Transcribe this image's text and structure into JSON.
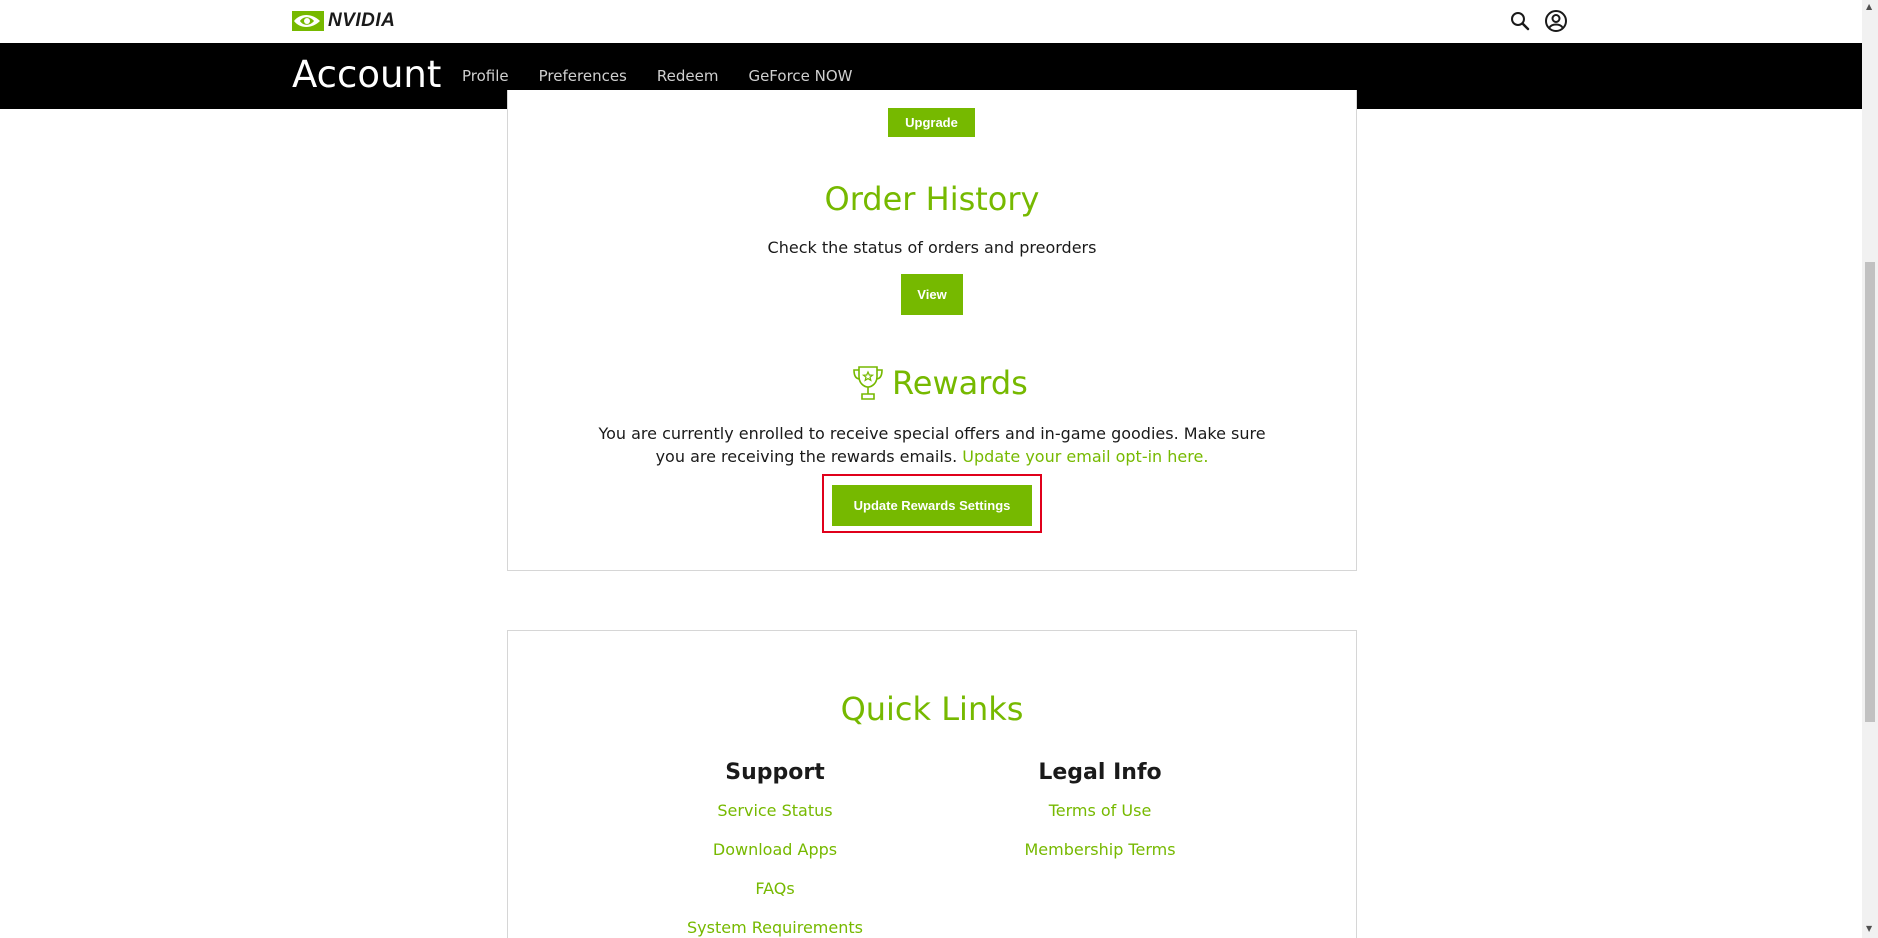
{
  "brand": {
    "logo_text": "NVIDIA",
    "accent_color": "#76b900"
  },
  "header": {
    "icons": [
      "search-icon",
      "account-icon"
    ]
  },
  "nav": {
    "title": "Account",
    "links": [
      "Profile",
      "Preferences",
      "Redeem",
      "GeForce NOW"
    ]
  },
  "membership": {
    "upgrade_label": "Upgrade"
  },
  "order_history": {
    "title": "Order History",
    "description": "Check the status of orders and preorders",
    "button_label": "View"
  },
  "rewards": {
    "title": "Rewards",
    "description_line1": "You are currently enrolled to receive special offers and in-game goodies. Make sure",
    "description_line2": "you are receiving the rewards emails.",
    "optin_link": "Update your email opt-in here.",
    "button_label": "Update Rewards Settings"
  },
  "quick_links": {
    "title": "Quick Links",
    "support": {
      "heading": "Support",
      "links": [
        "Service Status",
        "Download Apps",
        "FAQs",
        "System Requirements"
      ]
    },
    "legal": {
      "heading": "Legal Info",
      "links": [
        "Terms of Use",
        "Membership Terms"
      ]
    }
  }
}
